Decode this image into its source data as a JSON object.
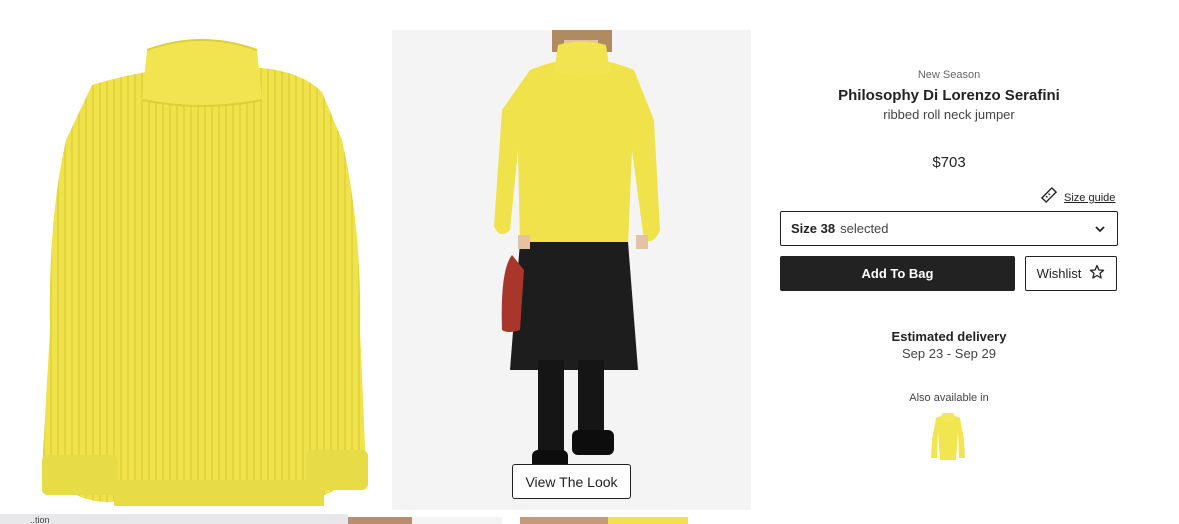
{
  "product": {
    "badge": "New Season",
    "brand": "Philosophy Di Lorenzo Serafini",
    "description": "ribbed roll neck jumper",
    "price": "$703"
  },
  "size": {
    "guide_label": "Size guide",
    "value": "Size 38",
    "state": "selected"
  },
  "actions": {
    "add_to_bag": "Add To Bag",
    "wishlist": "Wishlist"
  },
  "delivery": {
    "title": "Estimated delivery",
    "dates": "Sep 23 - Sep 29"
  },
  "also_available": {
    "label": "Also available in"
  },
  "gallery": {
    "view_look": "View The Look"
  },
  "bottom_bar": {
    "text": "..tion"
  },
  "colors": {
    "accent": "#222222",
    "jumper": "#f1e64f",
    "background": "#ffffff"
  }
}
